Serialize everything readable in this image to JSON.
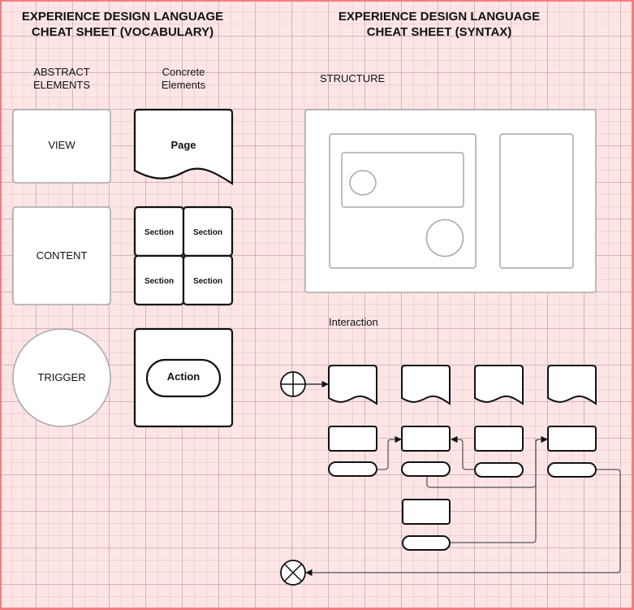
{
  "vocabulary": {
    "title": "EXPERIENCE DESIGN LANGUAGE\nCHEAT SHEET (VOCABULARY)",
    "abstract_header": "ABSTRACT\nELEMENTS",
    "concrete_header": "Concrete\nElements",
    "abstract_elements": [
      {
        "label": "VIEW",
        "shape": "rounded-rectangle"
      },
      {
        "label": "CONTENT",
        "shape": "rounded-rectangle"
      },
      {
        "label": "TRIGGER",
        "shape": "circle"
      }
    ],
    "concrete_elements": {
      "page": "Page",
      "sections": [
        "Section",
        "Section",
        "Section",
        "Section"
      ],
      "action": "Action"
    }
  },
  "syntax": {
    "title": "EXPERIENCE DESIGN LANGUAGE\nCHEAT SHEET (SYNTAX)",
    "structure_label": "STRUCTURE",
    "interaction_label": "Interaction",
    "start_icon": "crosshair-circle-start",
    "end_icon": "x-circle-end"
  },
  "colors": {
    "background": "#fde5e6",
    "frame": "#f47c7f",
    "abstract_stroke": "#a8a8a8",
    "concrete_stroke": "#111111",
    "connector": "#555555"
  }
}
